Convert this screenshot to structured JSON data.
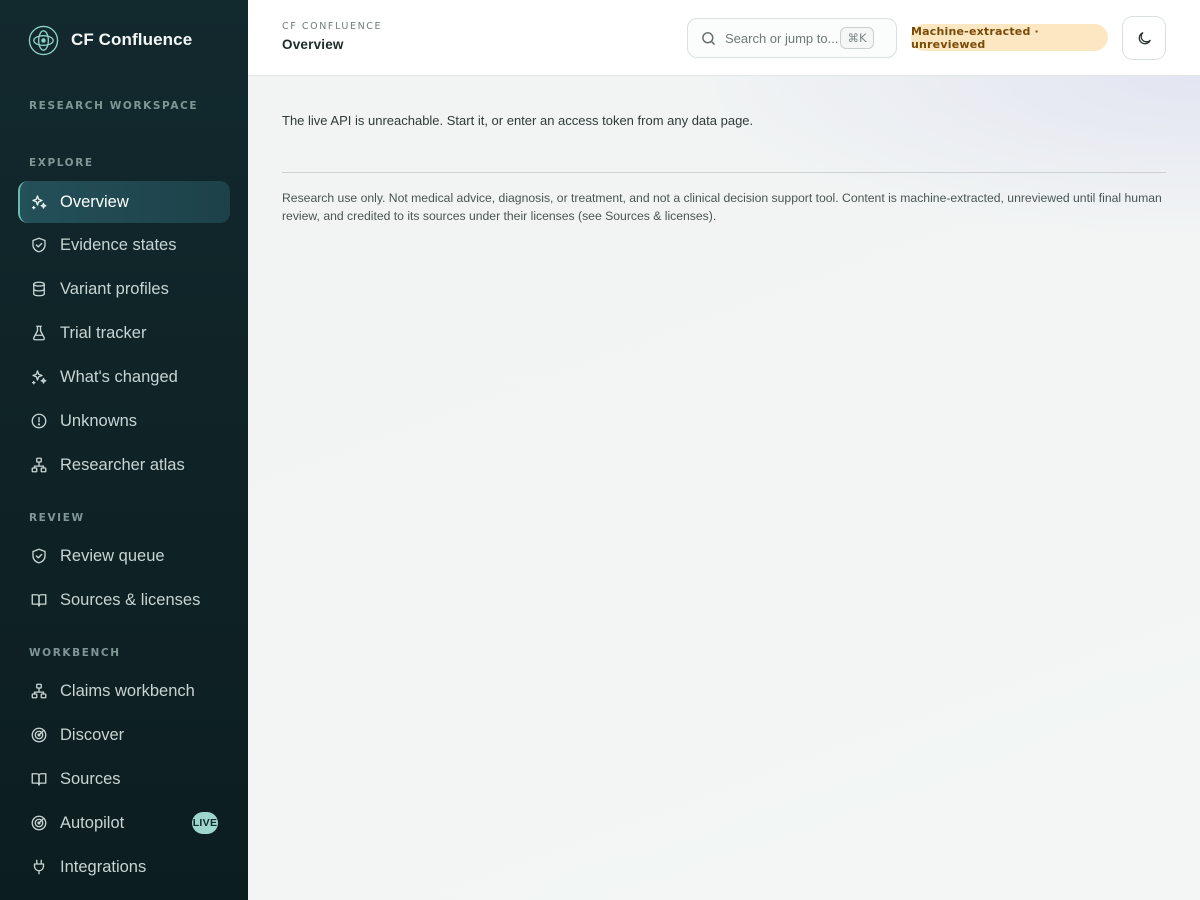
{
  "brand": {
    "name": "CF Confluence",
    "icon": "atom-logo-icon"
  },
  "sidebar": {
    "workspace_label": "RESEARCH WORKSPACE",
    "sections": [
      {
        "label": "EXPLORE",
        "items": [
          {
            "label": "Overview",
            "icon": "sparkles-icon",
            "active": true
          },
          {
            "label": "Evidence states",
            "icon": "shield-check-icon"
          },
          {
            "label": "Variant profiles",
            "icon": "database-icon"
          },
          {
            "label": "Trial tracker",
            "icon": "flask-icon"
          },
          {
            "label": "What's changed",
            "icon": "sparkles-icon"
          },
          {
            "label": "Unknowns",
            "icon": "alert-circle-icon"
          },
          {
            "label": "Researcher atlas",
            "icon": "network-icon"
          }
        ]
      },
      {
        "label": "REVIEW",
        "items": [
          {
            "label": "Review queue",
            "icon": "shield-check-icon"
          },
          {
            "label": "Sources & licenses",
            "icon": "book-open-icon"
          }
        ]
      },
      {
        "label": "WORKBENCH",
        "items": [
          {
            "label": "Claims workbench",
            "icon": "network-icon"
          },
          {
            "label": "Discover",
            "icon": "radar-icon"
          },
          {
            "label": "Sources",
            "icon": "book-open-icon"
          },
          {
            "label": "Autopilot",
            "icon": "radar-icon",
            "badge": "LIVE"
          },
          {
            "label": "Integrations",
            "icon": "plug-icon"
          }
        ]
      }
    ]
  },
  "header": {
    "crumb_small": "CF CONFLUENCE",
    "title": "Overview",
    "search_placeholder": "Search or jump to...",
    "search_shortcut": "⌘K",
    "status_badge": "Machine-extracted · unreviewed",
    "theme_toggle_icon": "moon-icon"
  },
  "main": {
    "api_message": "The live API is unreachable. Start it, or enter an access token from any data page.",
    "disclaimer": "Research use only. Not medical advice, diagnosis, or treatment, and not a clinical decision support tool. Content is machine-extracted, unreviewed until final human review, and credited to its sources under their licenses (see Sources & licenses)."
  },
  "colors": {
    "sidebar_bg": "#10262a",
    "active_item_bg": "#24505a",
    "accent": "#6fb8ad",
    "status_badge_bg": "#fbe7c2",
    "status_badge_text": "#7a4a07",
    "live_badge_bg": "#9fd6cb"
  }
}
